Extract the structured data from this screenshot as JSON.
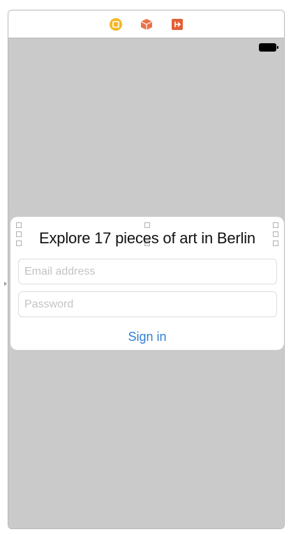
{
  "scene_dock": {
    "icons": [
      "view-controller-icon",
      "first-responder-icon",
      "exit-icon"
    ],
    "colors": {
      "view_controller": "#f5b727",
      "first_responder": "#e8734a",
      "exit": "#e35f35"
    }
  },
  "status_bar": {
    "battery_icon": "battery-icon"
  },
  "card": {
    "title": "Explore 17 pieces of art in Berlin",
    "email_placeholder": "Email address",
    "password_placeholder": "Password",
    "signin_label": "Sign in"
  },
  "colors": {
    "canvas": "#cacaca",
    "link": "#2f7fd4",
    "card": "#ffffff"
  }
}
